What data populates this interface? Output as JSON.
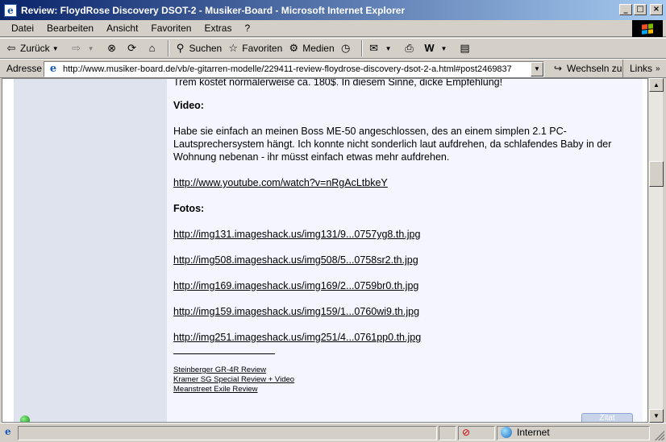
{
  "window": {
    "title": "Review: FloydRose Discovery DSOT-2 - Musiker-Board - Microsoft Internet Explorer",
    "controls": {
      "minimize": "_",
      "maximize": "□",
      "close": "×"
    }
  },
  "menu": [
    "Datei",
    "Bearbeiten",
    "Ansicht",
    "Favoriten",
    "Extras",
    "?"
  ],
  "toolbar": {
    "back_label": "Zurück",
    "search_label": "Suchen",
    "favorites_label": "Favoriten",
    "media_label": "Medien"
  },
  "address": {
    "label": "Adresse",
    "url": "http://www.musiker-board.de/vb/e-gitarren-modelle/229411-review-floydrose-discovery-dsot-2-a.html#post2469837",
    "go_label": "Wechseln zu",
    "links_label": "Links"
  },
  "post": {
    "top_line": "Trem kostet normalerweise ca. 180$. In diesem Sinne, dicke Empfehlung!",
    "video_heading": "Video:",
    "video_text": "Habe sie einfach an meinen Boss ME-50 angeschlossen, des an einem simplen 2.1 PC-Lautsprechersystem hängt. Ich konnte nicht sonderlich laut aufdrehen, da schlafendes Baby in der Wohnung nebenan - ihr müsst einfach etwas mehr aufdrehen.",
    "video_link": "http://www.youtube.com/watch?v=nRgAcLtbkeY",
    "photos_heading": "Fotos:",
    "photo_links": [
      "http://img131.imageshack.us/img131/9...0757yg8.th.jpg",
      "http://img508.imageshack.us/img508/5...0758sr2.th.jpg",
      "http://img169.imageshack.us/img169/2...0759br0.th.jpg",
      "http://img159.imageshack.us/img159/1...0760wi9.th.jpg",
      "http://img251.imageshack.us/img251/4...0761pp0.th.jpg"
    ],
    "signature_links": [
      "Steinberger GR-4R Review",
      "Kramer SG Special Review + Video",
      "Meanstreet Exile Review"
    ],
    "quote_button": "Zitat"
  },
  "status": {
    "zone": "Internet"
  }
}
